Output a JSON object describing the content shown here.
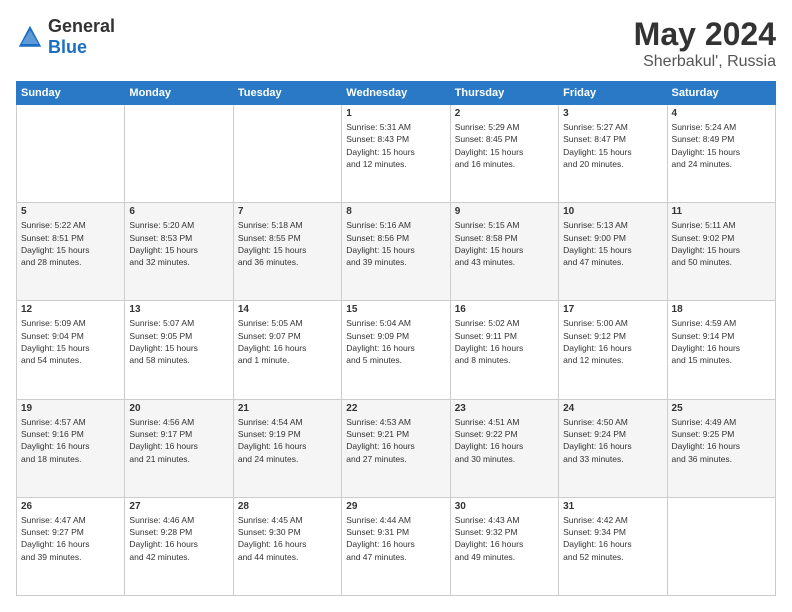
{
  "header": {
    "logo_general": "General",
    "logo_blue": "Blue",
    "title": "May 2024",
    "location": "Sherbakul', Russia"
  },
  "days_of_week": [
    "Sunday",
    "Monday",
    "Tuesday",
    "Wednesday",
    "Thursday",
    "Friday",
    "Saturday"
  ],
  "weeks": [
    [
      {
        "day": "",
        "content": ""
      },
      {
        "day": "",
        "content": ""
      },
      {
        "day": "",
        "content": ""
      },
      {
        "day": "1",
        "content": "Sunrise: 5:31 AM\nSunset: 8:43 PM\nDaylight: 15 hours\nand 12 minutes."
      },
      {
        "day": "2",
        "content": "Sunrise: 5:29 AM\nSunset: 8:45 PM\nDaylight: 15 hours\nand 16 minutes."
      },
      {
        "day": "3",
        "content": "Sunrise: 5:27 AM\nSunset: 8:47 PM\nDaylight: 15 hours\nand 20 minutes."
      },
      {
        "day": "4",
        "content": "Sunrise: 5:24 AM\nSunset: 8:49 PM\nDaylight: 15 hours\nand 24 minutes."
      }
    ],
    [
      {
        "day": "5",
        "content": "Sunrise: 5:22 AM\nSunset: 8:51 PM\nDaylight: 15 hours\nand 28 minutes."
      },
      {
        "day": "6",
        "content": "Sunrise: 5:20 AM\nSunset: 8:53 PM\nDaylight: 15 hours\nand 32 minutes."
      },
      {
        "day": "7",
        "content": "Sunrise: 5:18 AM\nSunset: 8:55 PM\nDaylight: 15 hours\nand 36 minutes."
      },
      {
        "day": "8",
        "content": "Sunrise: 5:16 AM\nSunset: 8:56 PM\nDaylight: 15 hours\nand 39 minutes."
      },
      {
        "day": "9",
        "content": "Sunrise: 5:15 AM\nSunset: 8:58 PM\nDaylight: 15 hours\nand 43 minutes."
      },
      {
        "day": "10",
        "content": "Sunrise: 5:13 AM\nSunset: 9:00 PM\nDaylight: 15 hours\nand 47 minutes."
      },
      {
        "day": "11",
        "content": "Sunrise: 5:11 AM\nSunset: 9:02 PM\nDaylight: 15 hours\nand 50 minutes."
      }
    ],
    [
      {
        "day": "12",
        "content": "Sunrise: 5:09 AM\nSunset: 9:04 PM\nDaylight: 15 hours\nand 54 minutes."
      },
      {
        "day": "13",
        "content": "Sunrise: 5:07 AM\nSunset: 9:05 PM\nDaylight: 15 hours\nand 58 minutes."
      },
      {
        "day": "14",
        "content": "Sunrise: 5:05 AM\nSunset: 9:07 PM\nDaylight: 16 hours\nand 1 minute."
      },
      {
        "day": "15",
        "content": "Sunrise: 5:04 AM\nSunset: 9:09 PM\nDaylight: 16 hours\nand 5 minutes."
      },
      {
        "day": "16",
        "content": "Sunrise: 5:02 AM\nSunset: 9:11 PM\nDaylight: 16 hours\nand 8 minutes."
      },
      {
        "day": "17",
        "content": "Sunrise: 5:00 AM\nSunset: 9:12 PM\nDaylight: 16 hours\nand 12 minutes."
      },
      {
        "day": "18",
        "content": "Sunrise: 4:59 AM\nSunset: 9:14 PM\nDaylight: 16 hours\nand 15 minutes."
      }
    ],
    [
      {
        "day": "19",
        "content": "Sunrise: 4:57 AM\nSunset: 9:16 PM\nDaylight: 16 hours\nand 18 minutes."
      },
      {
        "day": "20",
        "content": "Sunrise: 4:56 AM\nSunset: 9:17 PM\nDaylight: 16 hours\nand 21 minutes."
      },
      {
        "day": "21",
        "content": "Sunrise: 4:54 AM\nSunset: 9:19 PM\nDaylight: 16 hours\nand 24 minutes."
      },
      {
        "day": "22",
        "content": "Sunrise: 4:53 AM\nSunset: 9:21 PM\nDaylight: 16 hours\nand 27 minutes."
      },
      {
        "day": "23",
        "content": "Sunrise: 4:51 AM\nSunset: 9:22 PM\nDaylight: 16 hours\nand 30 minutes."
      },
      {
        "day": "24",
        "content": "Sunrise: 4:50 AM\nSunset: 9:24 PM\nDaylight: 16 hours\nand 33 minutes."
      },
      {
        "day": "25",
        "content": "Sunrise: 4:49 AM\nSunset: 9:25 PM\nDaylight: 16 hours\nand 36 minutes."
      }
    ],
    [
      {
        "day": "26",
        "content": "Sunrise: 4:47 AM\nSunset: 9:27 PM\nDaylight: 16 hours\nand 39 minutes."
      },
      {
        "day": "27",
        "content": "Sunrise: 4:46 AM\nSunset: 9:28 PM\nDaylight: 16 hours\nand 42 minutes."
      },
      {
        "day": "28",
        "content": "Sunrise: 4:45 AM\nSunset: 9:30 PM\nDaylight: 16 hours\nand 44 minutes."
      },
      {
        "day": "29",
        "content": "Sunrise: 4:44 AM\nSunset: 9:31 PM\nDaylight: 16 hours\nand 47 minutes."
      },
      {
        "day": "30",
        "content": "Sunrise: 4:43 AM\nSunset: 9:32 PM\nDaylight: 16 hours\nand 49 minutes."
      },
      {
        "day": "31",
        "content": "Sunrise: 4:42 AM\nSunset: 9:34 PM\nDaylight: 16 hours\nand 52 minutes."
      },
      {
        "day": "",
        "content": ""
      }
    ]
  ]
}
